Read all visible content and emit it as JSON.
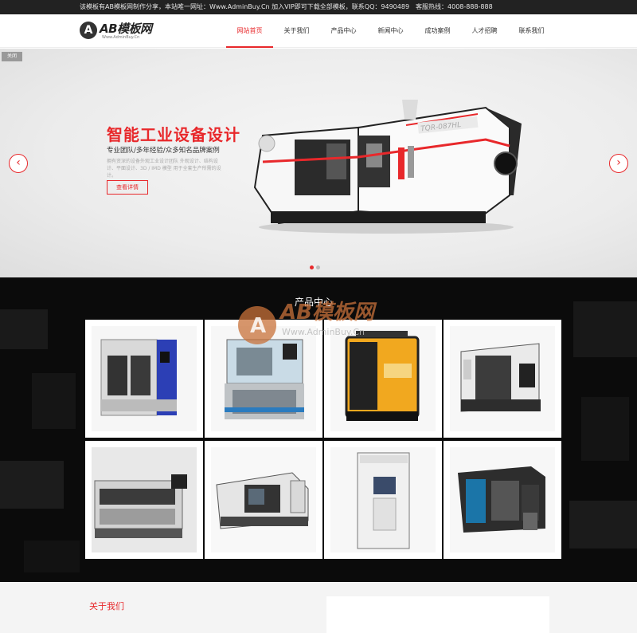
{
  "topbar": {
    "notice": "该模板有AB模板网制作分享，本站唯一网址：Www.AdminBuy.Cn 加入VIP即可下载全部模板，联系QQ：9490489　客服热线：4008-888-888"
  },
  "logo": {
    "letter": "A",
    "name": "AB模板网",
    "sub": "Www.AdminBuy.Cn"
  },
  "nav": {
    "items": [
      {
        "label": "网站首页",
        "active": true
      },
      {
        "label": "关于我们"
      },
      {
        "label": "产品中心"
      },
      {
        "label": "新闻中心"
      },
      {
        "label": "成功案例"
      },
      {
        "label": "人才招聘"
      },
      {
        "label": "联系我们"
      }
    ]
  },
  "banner": {
    "close_label": "关闭",
    "title": "智能工业设备设计",
    "subtitle": "专业团队/多年经验/众多知名品牌案例",
    "description": "拥有资深的设备外观工业设计团队 外观设计、结构设计、平面设计、3D / IMD 模型 用于全套生产所需的设计。",
    "button": "查看详情",
    "prev_icon": "‹",
    "next_icon": "›",
    "slides_total": 2,
    "slide_active": 1,
    "machine_label": "TQR-087HL",
    "accent": "#e8282b"
  },
  "products": {
    "title": "产品中心",
    "watermark_main": "AB模板网",
    "watermark_sub": "Www.AdminBuy.Cn",
    "items": [
      {
        "name": "vertical-machining-center"
      },
      {
        "name": "cnc-glass-machine"
      },
      {
        "name": "welding-machine"
      },
      {
        "name": "cnc-lathe"
      },
      {
        "name": "laser-cutting-machine"
      },
      {
        "name": "engraving-machine"
      },
      {
        "name": "power-cabinet"
      },
      {
        "name": "machining-center"
      }
    ]
  },
  "about": {
    "title": "关于我们"
  }
}
